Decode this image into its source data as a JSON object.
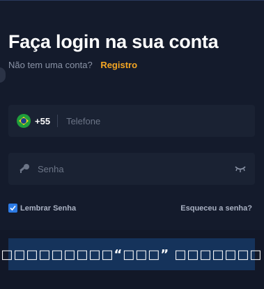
{
  "title": "Faça login na sua conta",
  "subtitle": {
    "text": "Não tem uma conta?",
    "link": "Registro"
  },
  "phone": {
    "flag": "brazil-flag-icon",
    "code": "+55",
    "placeholder": "Telefone"
  },
  "password": {
    "icon": "key-icon",
    "placeholder": "Senha",
    "toggle_icon": "eye-closed-icon"
  },
  "remember": {
    "label": "Lembrar Senha",
    "checked": true
  },
  "forgot_label": "Esqueceu a senha?",
  "submit_label": "□□□□□□□□□“□□□” □□□□□□□",
  "colors": {
    "accent": "#f5a623",
    "checkbox": "#2d7be5",
    "submit_bg": "#15335b",
    "bg": "#141b2c"
  }
}
